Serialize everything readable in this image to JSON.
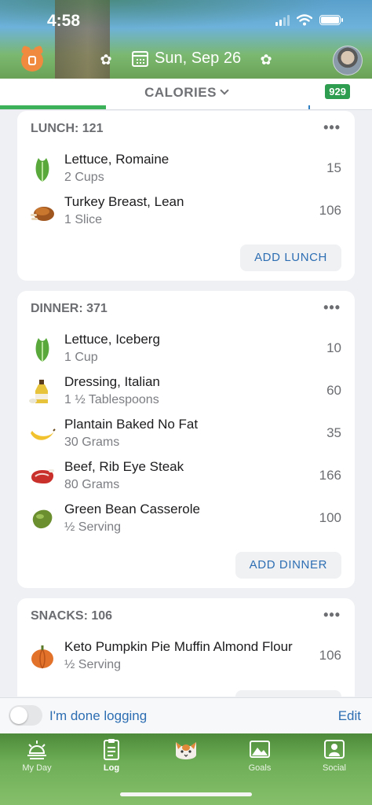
{
  "status": {
    "time": "4:58"
  },
  "header": {
    "date": "Sun, Sep 26"
  },
  "calories_bar": {
    "label": "CALORIES",
    "remaining": "929",
    "progress_fraction": 0.285
  },
  "lunch": {
    "title": "LUNCH: 121",
    "items": [
      {
        "name": "Lettuce, Romaine",
        "amount": "2 Cups",
        "calories": "15",
        "icon": "lettuce-icon"
      },
      {
        "name": "Turkey Breast, Lean",
        "amount": "1 Slice",
        "calories": "106",
        "icon": "turkey-icon"
      }
    ],
    "add_label": "ADD LUNCH"
  },
  "dinner": {
    "title": "DINNER: 371",
    "items": [
      {
        "name": "Lettuce, Iceberg",
        "amount": "1 Cup",
        "calories": "10",
        "icon": "lettuce-icon"
      },
      {
        "name": "Dressing, Italian",
        "amount": "1 ½ Tablespoons",
        "calories": "60",
        "icon": "dressing-bottle-icon"
      },
      {
        "name": "Plantain Baked No Fat",
        "amount": "30 Grams",
        "calories": "35",
        "icon": "banana-icon"
      },
      {
        "name": "Beef, Rib Eye Steak",
        "amount": "80 Grams",
        "calories": "166",
        "icon": "steak-icon"
      },
      {
        "name": "Green Bean Casserole",
        "amount": "½ Serving",
        "calories": "100",
        "icon": "bean-icon"
      }
    ],
    "add_label": "ADD DINNER"
  },
  "snacks": {
    "title": "SNACKS: 106",
    "items": [
      {
        "name": "Keto Pumpkin Pie Muffin Almond Flour",
        "amount": "½ Serving",
        "calories": "106",
        "icon": "pumpkin-icon"
      }
    ]
  },
  "footer": {
    "done_label": "I'm done logging",
    "edit_label": "Edit"
  },
  "tabs": [
    {
      "label": "My Day",
      "icon": "sunrise-icon"
    },
    {
      "label": "Log",
      "icon": "clipboard-icon"
    },
    {
      "label": "",
      "icon": "cat-mascot-icon"
    },
    {
      "label": "Goals",
      "icon": "mountain-icon"
    },
    {
      "label": "Social",
      "icon": "people-icon"
    }
  ],
  "colors": {
    "accent_blue": "#2d6eb3",
    "progress_green": "#3cb15a",
    "badge_green": "#2f9d4f"
  }
}
